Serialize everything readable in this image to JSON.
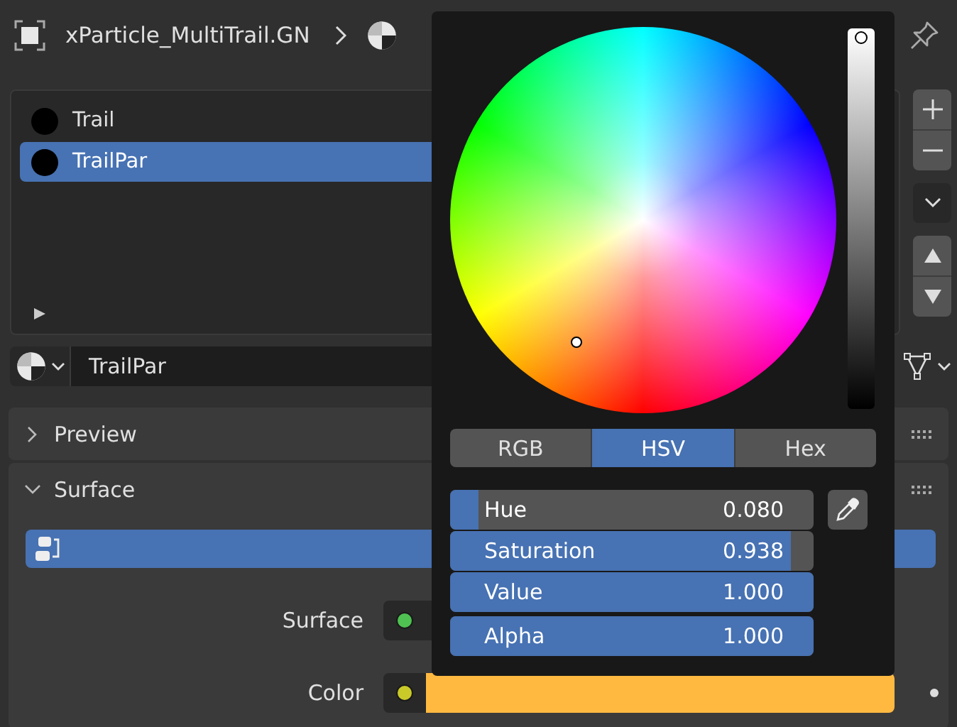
{
  "header": {
    "title": "xParticle_MultiTrail.GN"
  },
  "material_slots": [
    {
      "name": "Trail",
      "selected": false
    },
    {
      "name": "TrailPar",
      "selected": true
    }
  ],
  "material_field": {
    "value": "TrailPar"
  },
  "panels": [
    {
      "title": "Preview",
      "expanded": false
    },
    {
      "title": "Surface",
      "expanded": true
    }
  ],
  "surface_rows": [
    {
      "label": "Surface",
      "kind": "socket",
      "color": "#4fc152"
    },
    {
      "label": "Color",
      "kind": "swatch",
      "color": "#c9c92a",
      "swatch": {
        "color": "#ffb941"
      }
    }
  ],
  "color_picker": {
    "value_bar": {
      "level": 1
    },
    "tabs": [
      {
        "label": "RGB",
        "selected": false
      },
      {
        "label": "HSV",
        "selected": true
      },
      {
        "label": "Hex",
        "selected": false
      }
    ],
    "sliders": [
      {
        "label": "Hue",
        "value": "0.080",
        "level": 0.08
      },
      {
        "label": "Saturation",
        "value": "0.938",
        "level": 0.938
      },
      {
        "label": "Value",
        "value": "1.000",
        "level": 1
      },
      {
        "label": "Alpha",
        "value": "1.000",
        "level": 1
      }
    ]
  }
}
